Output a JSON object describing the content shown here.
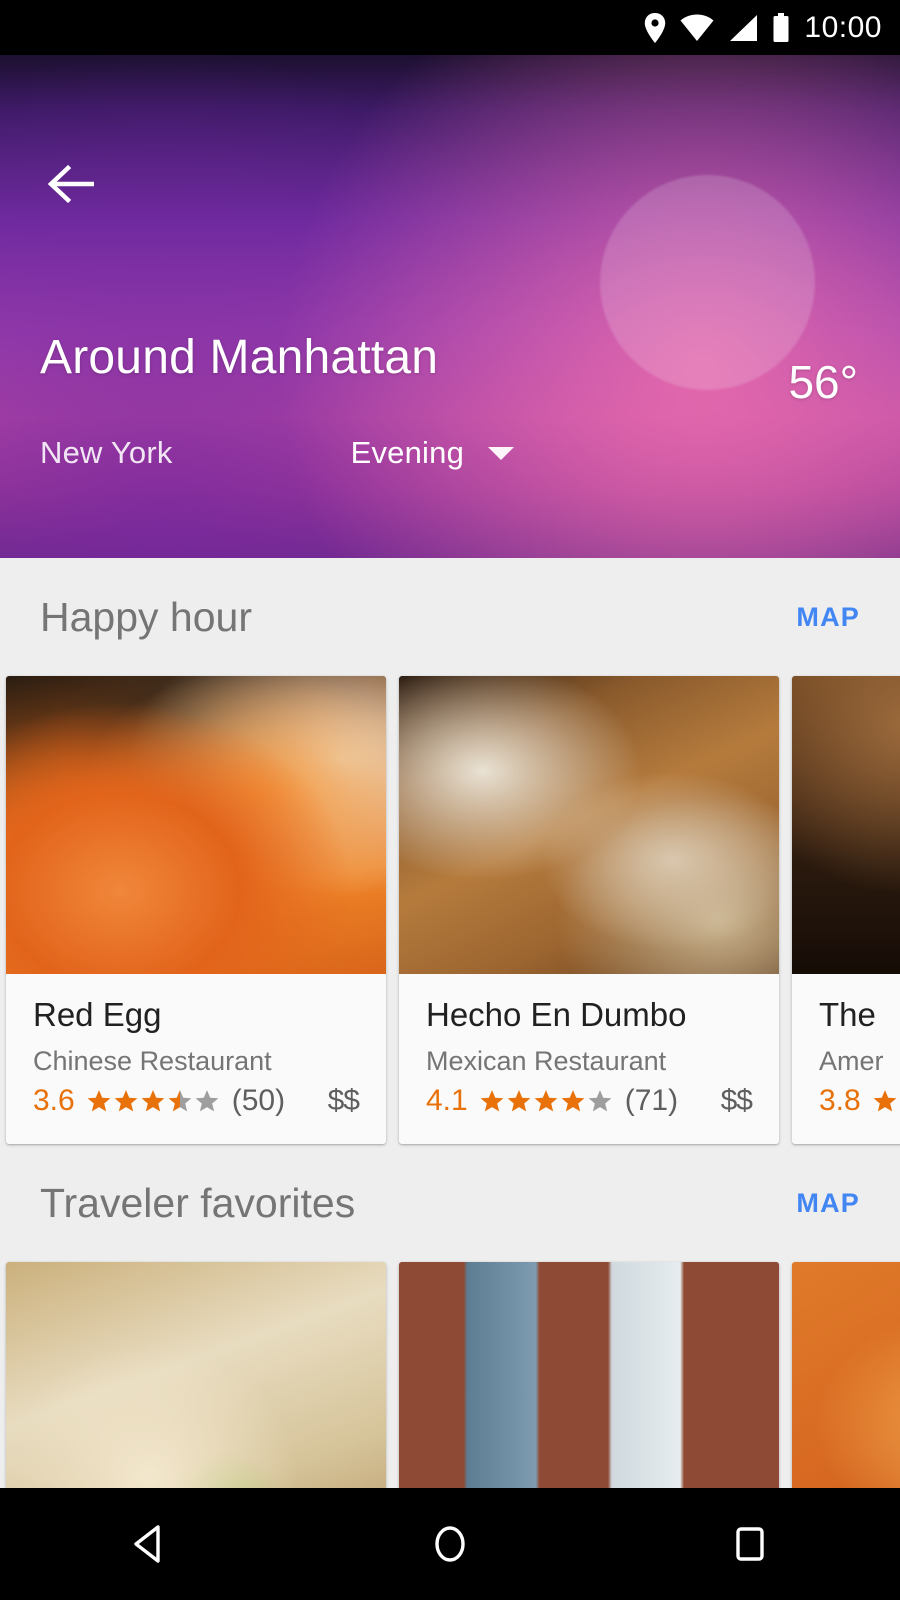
{
  "statusbar": {
    "time": "10:00",
    "icons": [
      "location-pin-icon",
      "wifi-icon",
      "cell-signal-icon",
      "battery-icon"
    ]
  },
  "header": {
    "back_icon": "back-arrow-icon",
    "title": "Around Manhattan",
    "temperature": "56°",
    "city": "New York",
    "time_of_day": "Evening",
    "dropdown_icon": "chevron-down-icon",
    "accent_colors": {
      "gradient_top": "#1c1030",
      "gradient_mid": "#9a3fae",
      "gradient_pink": "#b94ba6",
      "gradient_bottom": "#6d2a86"
    }
  },
  "sections": [
    {
      "title": "Happy hour",
      "map_label": "MAP",
      "cards": [
        {
          "name": "Red Egg",
          "category": "Chinese Restaurant",
          "rating": "3.6",
          "stars_filled": 3,
          "stars_half": 1,
          "stars_empty": 1,
          "reviews": "(50)",
          "price": "$$",
          "image": "sesame-chicken-photo"
        },
        {
          "name": "Hecho En Dumbo",
          "category": "Mexican Restaurant",
          "rating": "4.1",
          "stars_filled": 4,
          "stars_half": 0,
          "stars_empty": 1,
          "reviews": "(71)",
          "price": "$$",
          "image": "tacos-cocktail-photo"
        },
        {
          "name": "The",
          "category": "Amer",
          "rating": "3.8",
          "stars_filled": 1,
          "stars_half": 0,
          "stars_empty": 0,
          "reviews": "",
          "price": "",
          "image": "bar-interior-photo"
        }
      ]
    },
    {
      "title": "Traveler favorites",
      "map_label": "MAP",
      "cards": [
        {
          "image": "dumpling-plate-photo"
        },
        {
          "image": "brick-building-windows-photo"
        },
        {
          "image": "pizza-photo"
        }
      ]
    }
  ],
  "navbar": {
    "back_label": "back-nav",
    "home_label": "home-nav",
    "recents_label": "recents-nav"
  },
  "colors": {
    "rating_orange": "#e8710a",
    "star_gray": "#9e9e9e",
    "map_blue": "#4286f4",
    "section_title": "#757575",
    "background": "#eeeeee",
    "card_bg": "#fafafa"
  }
}
